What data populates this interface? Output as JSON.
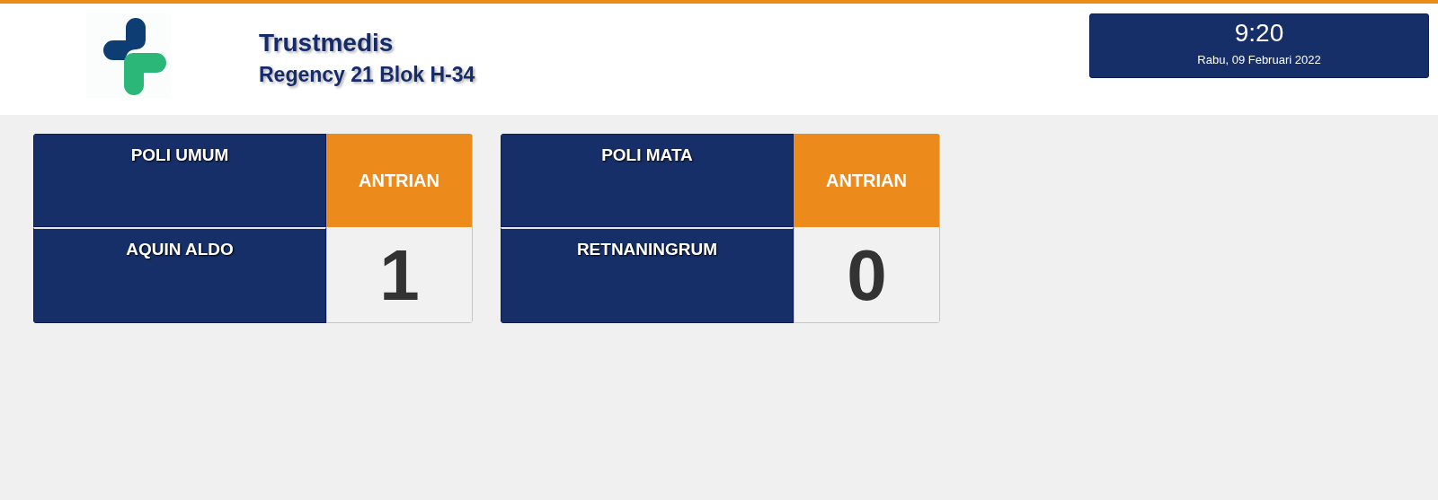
{
  "header": {
    "title": "Trustmedis",
    "subtitle": "Regency 21 Blok H-34"
  },
  "clock": {
    "time": "9:20",
    "date": "Rabu, 09 Februari 2022"
  },
  "counters": [
    {
      "poli": "POLI UMUM",
      "label": "ANTRIAN",
      "doctor": "AQUIN ALDO",
      "number": "1"
    },
    {
      "poli": "POLI MATA",
      "label": "ANTRIAN",
      "doctor": "RETNANINGRUM",
      "number": "0"
    }
  ]
}
